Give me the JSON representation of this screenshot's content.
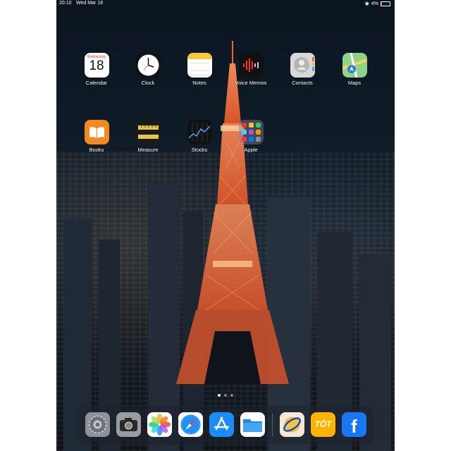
{
  "status_bar": {
    "time": "20:10",
    "date": "Wed Mar 18",
    "battery": "4%"
  },
  "apps_row1": [
    {
      "label": "Calendar"
    },
    {
      "label": "Clock"
    },
    {
      "label": "Notes"
    },
    {
      "label": "Voice Memos"
    },
    {
      "label": "Contacts"
    },
    {
      "label": "Maps"
    }
  ],
  "apps_row2": [
    {
      "label": "Books"
    },
    {
      "label": "Measure"
    },
    {
      "label": "Stocks"
    },
    {
      "label": "Apple"
    }
  ],
  "calendar_icon": {
    "weekday": "Wednesday",
    "day": "18"
  },
  "page_indicator": {
    "pages": 3,
    "current": 1
  },
  "dock": [
    {
      "icon": "settings-icon"
    },
    {
      "icon": "camera-icon"
    },
    {
      "icon": "photos-icon"
    },
    {
      "icon": "safari-icon"
    },
    {
      "icon": "app-store-icon"
    },
    {
      "icon": "files-icon"
    },
    {
      "icon": "app-icon"
    },
    {
      "icon": "tot-icon",
      "text": "TỐT"
    },
    {
      "icon": "facebook-icon",
      "text": "f"
    }
  ],
  "colors": {
    "tower": "#e86a3a",
    "dock_bg": "#1e232d"
  }
}
